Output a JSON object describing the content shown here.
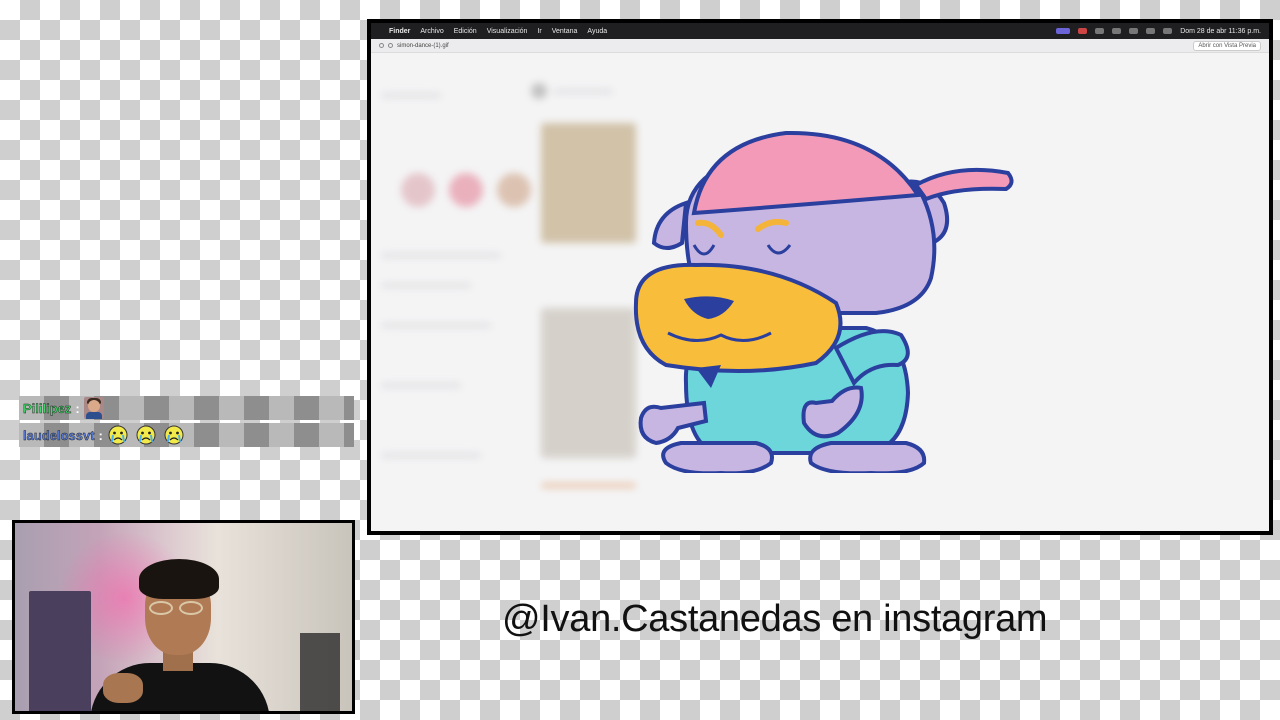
{
  "screen": {
    "menubar": {
      "apple_icon": "apple-icon",
      "app": "Finder",
      "items": [
        "Archivo",
        "Edición",
        "Visualización",
        "Ir",
        "Ventana",
        "Ayuda"
      ],
      "datetime": "Dom 28 de abr  11:36 p.m."
    },
    "preview_window": {
      "title": "simon-dance-(1).gif",
      "open_button": "Abrir con Vista Previa"
    }
  },
  "chat": [
    {
      "user": "Pililipez",
      "user_color": "#44d66a",
      "emotes": [
        "avatar-emote"
      ]
    },
    {
      "user": "laudelossvt",
      "user_color": "#5a7fe0",
      "emotes": [
        "crying-face-emote",
        "crying-face-emote",
        "crying-face-emote"
      ]
    }
  ],
  "caption": "@Ivan.Castanedas en instagram"
}
